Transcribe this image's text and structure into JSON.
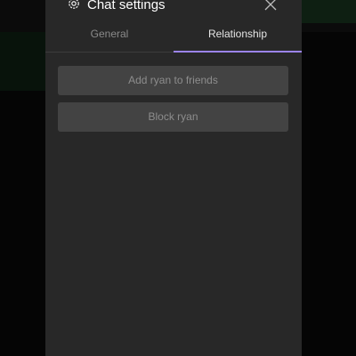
{
  "header": {
    "title": "Chat settings",
    "settings_icon": "gear-icon",
    "close_icon": "close-icon"
  },
  "tabs": [
    {
      "label": "General",
      "active": false
    },
    {
      "label": "Relationship",
      "active": true
    }
  ],
  "actions": {
    "add_friend_label": "Add ryan to friends",
    "block_label": "Block ryan"
  },
  "colors": {
    "panel_bg": "#282828",
    "accent": "#9b84ec",
    "button_bg": "#434343",
    "button_text": "#8d8d8d"
  }
}
